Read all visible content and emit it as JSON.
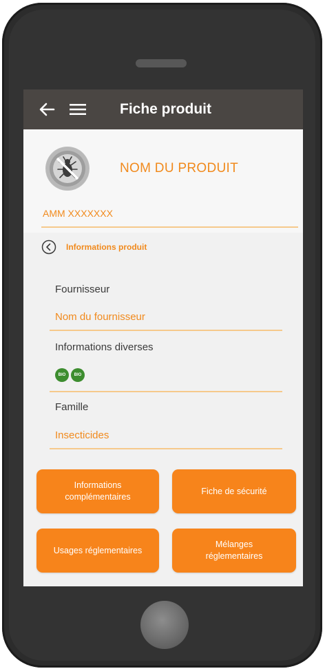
{
  "appbar": {
    "title": "Fiche produit",
    "back_icon": "arrow-left-icon",
    "menu_icon": "hamburger-menu-icon"
  },
  "product": {
    "name": "NOM DU PRODUIT",
    "amm": "AMM XXXXXXX",
    "avatar_icon": "insect-prohibited-icon"
  },
  "section": {
    "title": "Informations produit",
    "back_icon": "circle-chevron-left-icon"
  },
  "fields": {
    "supplier": {
      "label": "Fournisseur",
      "value": "Nom du fournisseur"
    },
    "misc": {
      "label": "Informations diverses",
      "badges": [
        "BIO PCTV",
        "BIO"
      ]
    },
    "family": {
      "label": "Famille",
      "value": "Insecticides"
    }
  },
  "buttons": {
    "info_line1": "Informations",
    "info_line2": "complémentaires",
    "safety": "Fiche de sécurité",
    "usages": "Usages réglementaires",
    "mix_line1": "Mélanges",
    "mix_line2": "réglementaires"
  },
  "colors": {
    "accent": "#f18a1d",
    "button": "#f7841b",
    "appbar": "#4a4643",
    "separator": "#f6c98b",
    "badge": "#3d8d2f"
  }
}
